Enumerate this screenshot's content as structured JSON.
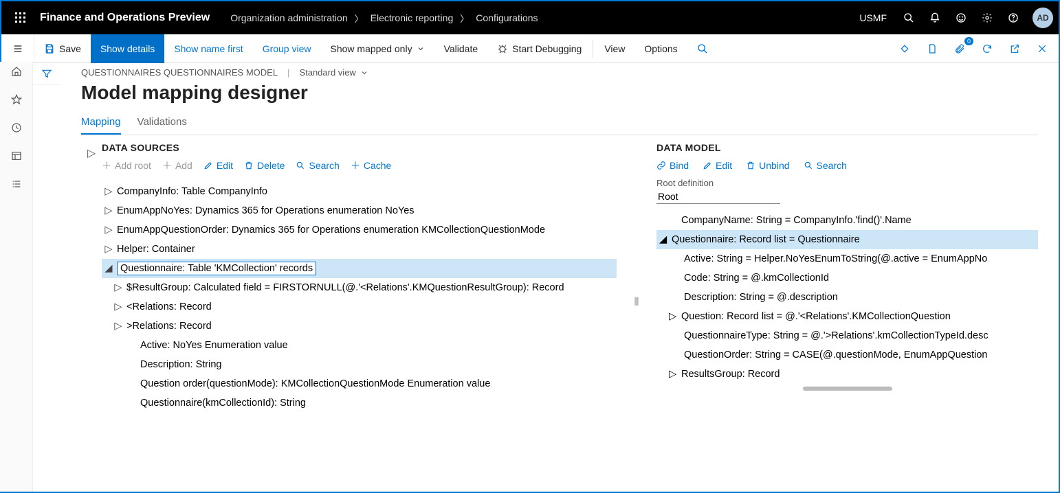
{
  "topbar": {
    "app_title": "Finance and Operations Preview",
    "breadcrumbs": [
      "Organization administration",
      "Electronic reporting",
      "Configurations"
    ],
    "entity": "USMF",
    "avatar": "AD"
  },
  "cmdbar": {
    "save": "Save",
    "show_details": "Show details",
    "show_name_first": "Show name first",
    "group_view": "Group view",
    "show_mapped_only": "Show mapped only",
    "validate": "Validate",
    "start_debugging": "Start Debugging",
    "view": "View",
    "options": "Options",
    "badge_count": "0"
  },
  "page": {
    "crumb": "QUESTIONNAIRES QUESTIONNAIRES MODEL",
    "view": "Standard view",
    "title": "Model mapping designer"
  },
  "tabs": {
    "mapping": "Mapping",
    "validations": "Validations"
  },
  "ds": {
    "title": "DATA SOURCES",
    "actions": {
      "add_root": "Add root",
      "add": "Add",
      "edit": "Edit",
      "delete": "Delete",
      "search": "Search",
      "cache": "Cache"
    },
    "items": [
      "CompanyInfo: Table CompanyInfo",
      "EnumAppNoYes: Dynamics 365 for Operations enumeration NoYes",
      "EnumAppQuestionOrder: Dynamics 365 for Operations enumeration KMCollectionQuestionMode",
      "Helper: Container",
      "Questionnaire: Table 'KMCollection' records"
    ],
    "children": [
      "$ResultGroup: Calculated field = FIRSTORNULL(@.'<Relations'.KMQuestionResultGroup): Record",
      "<Relations: Record",
      ">Relations: Record",
      "Active: NoYes Enumeration value",
      "Description: String",
      "Question order(questionMode): KMCollectionQuestionMode Enumeration value",
      "Questionnaire(kmCollectionId): String"
    ]
  },
  "dm": {
    "title": "DATA MODEL",
    "actions": {
      "bind": "Bind",
      "edit": "Edit",
      "unbind": "Unbind",
      "search": "Search"
    },
    "root_label": "Root definition",
    "root_value": "Root",
    "items": [
      "CompanyName: String = CompanyInfo.'find()'.Name",
      "Questionnaire: Record list = Questionnaire",
      "Active: String = Helper.NoYesEnumToString(@.active = EnumAppNo",
      "Code: String = @.kmCollectionId",
      "Description: String = @.description",
      "Question: Record list = @.'<Relations'.KMCollectionQuestion",
      "QuestionnaireType: String = @.'>Relations'.kmCollectionTypeId.desc",
      "QuestionOrder: String = CASE(@.questionMode, EnumAppQuestion",
      "ResultsGroup: Record"
    ]
  }
}
